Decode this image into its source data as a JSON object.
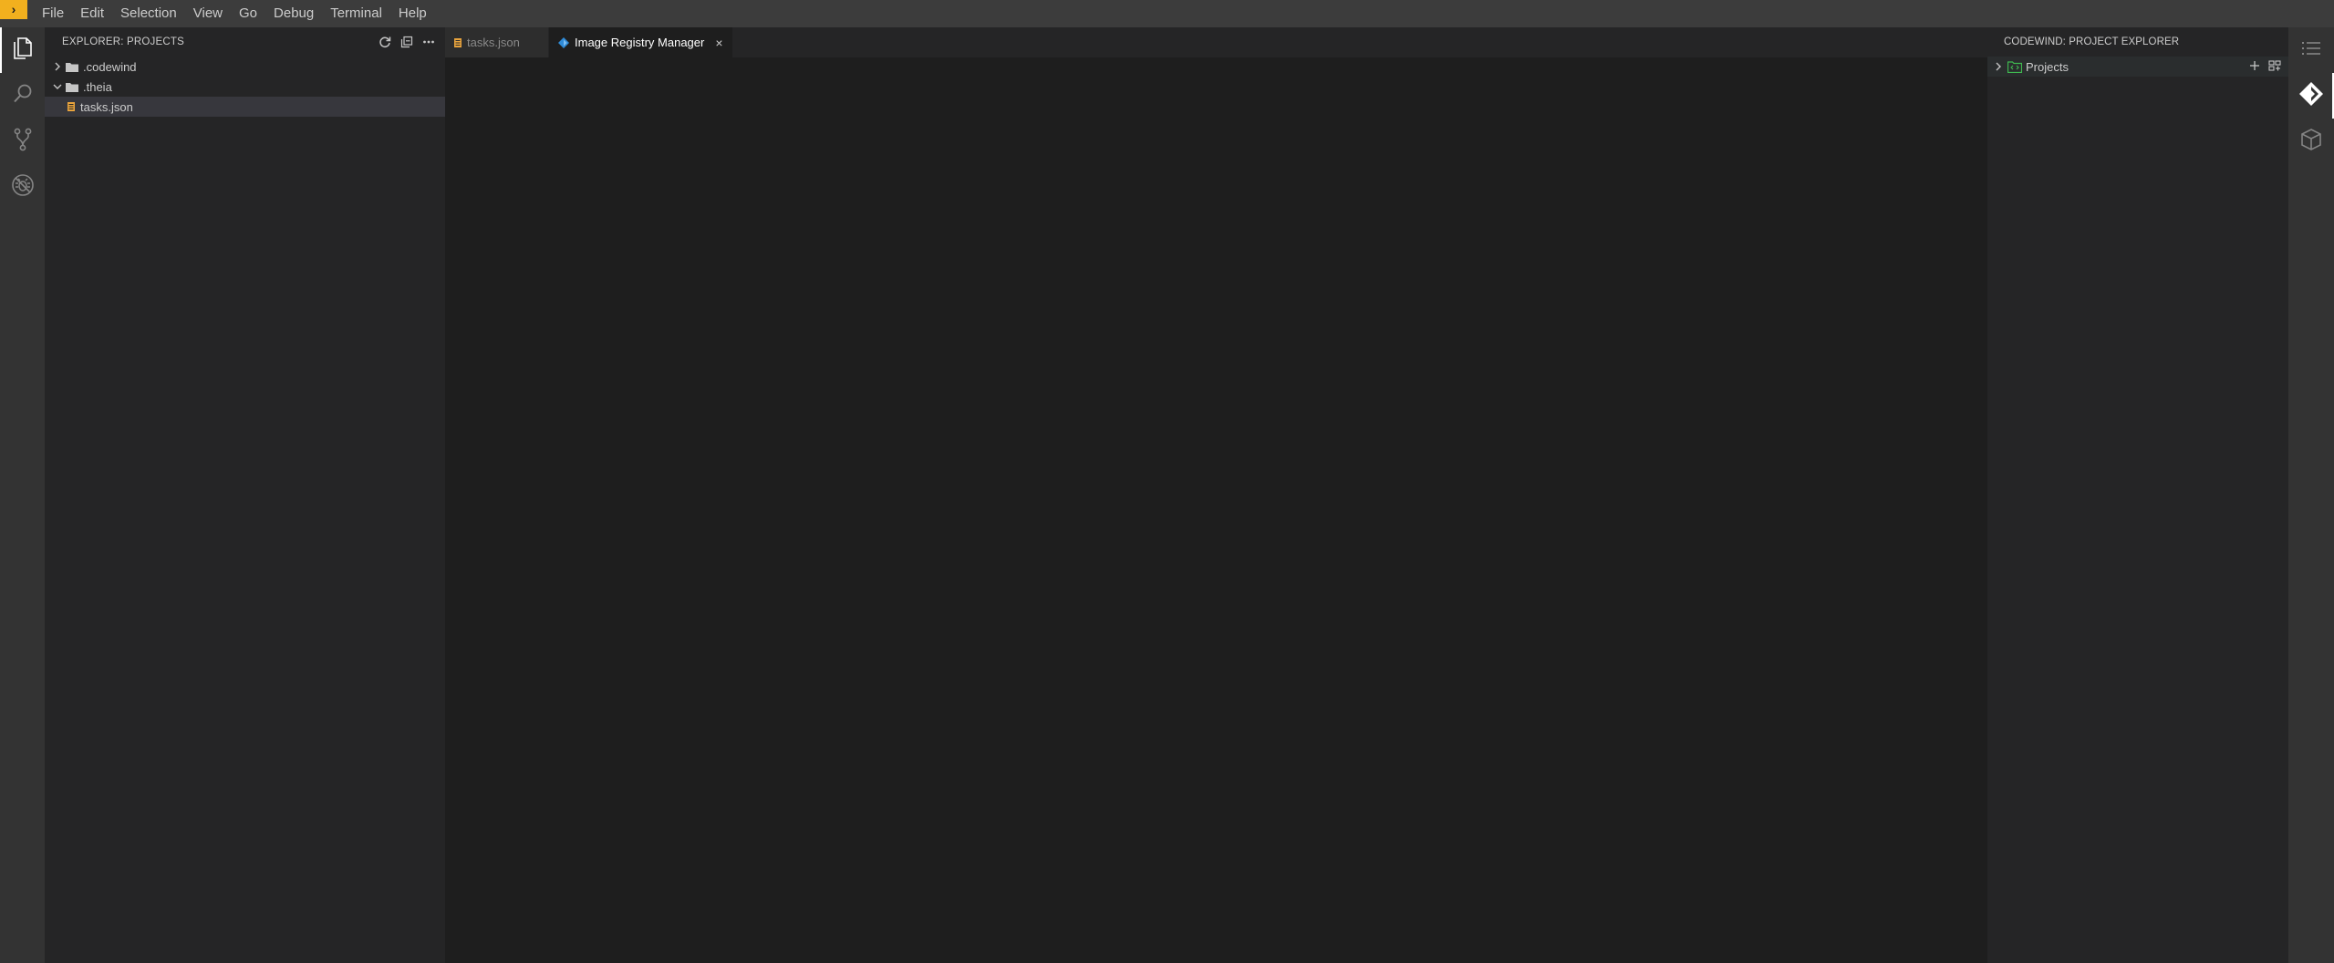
{
  "menu": {
    "items": [
      "File",
      "Edit",
      "Selection",
      "View",
      "Go",
      "Debug",
      "Terminal",
      "Help"
    ]
  },
  "activity_bar": {
    "items": [
      {
        "icon": "files-icon",
        "active": true
      },
      {
        "icon": "search-icon",
        "active": false
      },
      {
        "icon": "source-control-icon",
        "active": false
      },
      {
        "icon": "debug-icon",
        "active": false
      }
    ]
  },
  "explorer": {
    "title": "EXPLORER: PROJECTS",
    "actions": [
      "refresh-icon",
      "collapse-all-icon",
      "more-icon"
    ],
    "tree": [
      {
        "label": ".codewind",
        "type": "folder",
        "expanded": false
      },
      {
        "label": ".theia",
        "type": "folder",
        "expanded": true
      },
      {
        "label": "tasks.json",
        "type": "file",
        "selected": true
      }
    ]
  },
  "editor": {
    "tabs": [
      {
        "label": "tasks.json",
        "icon": "json-file-icon",
        "active": false
      },
      {
        "label": "Image Registry Manager",
        "icon": "codewind-icon",
        "active": true,
        "close": "×"
      }
    ]
  },
  "codewind": {
    "title": "CODEWIND: PROJECT EXPLORER",
    "root": {
      "label": "Projects",
      "expanded": false
    },
    "actions": [
      "add-icon",
      "registry-icon"
    ]
  },
  "right_bar": {
    "items": [
      "outline-icon",
      "codewind-icon",
      "containers-icon"
    ]
  },
  "colors": {
    "accent": "#f2b01e",
    "menubar": "#3c3c3c",
    "sidebar": "#252526",
    "editor": "#1e1e1e",
    "activitybar": "#333333",
    "selection": "#37373d",
    "codewind_blue": "#2f8bd8",
    "json_orange": "#e8a33d"
  }
}
